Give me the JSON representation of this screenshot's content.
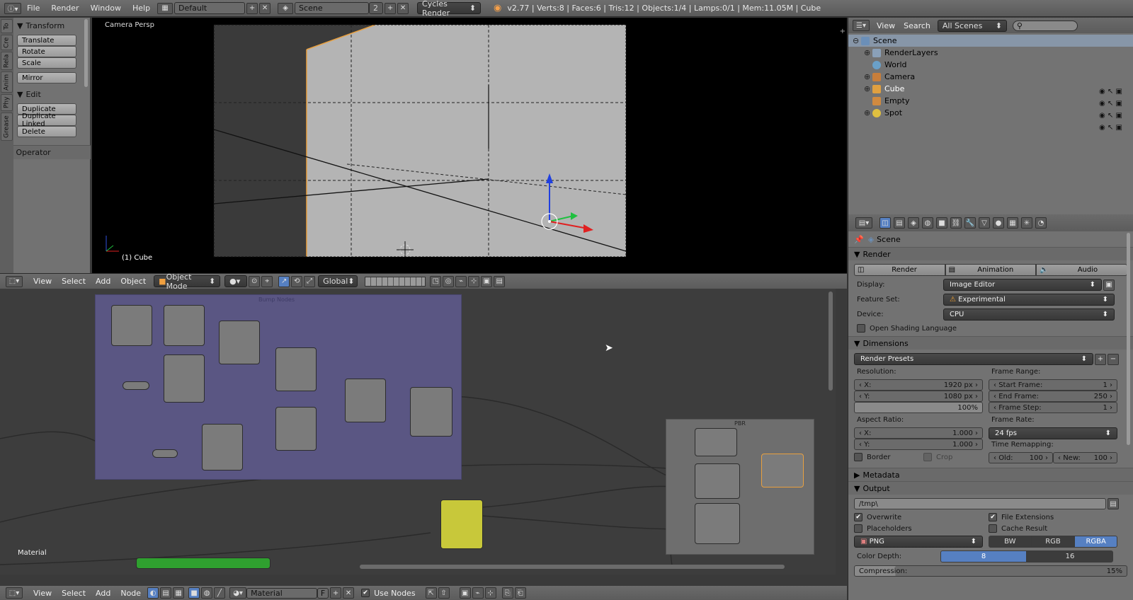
{
  "topbar": {
    "menus": [
      "File",
      "Render",
      "Window",
      "Help"
    ],
    "layout": "Default",
    "scene": "Scene",
    "scene_num": "2",
    "engine": "Cycles Render",
    "stats": "v2.77 | Verts:8 | Faces:6 | Tris:12 | Objects:1/4 | Lamps:0/1 | Mem:11.05M | Cube"
  },
  "toolshelf": {
    "tabs": [
      "To",
      "Cre",
      "Rela",
      "Anim",
      "Phy",
      "Grease"
    ],
    "transform_title": "Transform",
    "transform": [
      "Translate",
      "Rotate",
      "Scale"
    ],
    "mirror": "Mirror",
    "edit_title": "Edit",
    "edit": [
      "Duplicate",
      "Duplicate Linked",
      "Delete"
    ],
    "operator_title": "Operator"
  },
  "viewport": {
    "label": "Camera Persp",
    "object": "(1) Cube"
  },
  "view_header": {
    "menus": [
      "View",
      "Select",
      "Add",
      "Object"
    ],
    "mode": "Object Mode",
    "orientation": "Global"
  },
  "node_editor": {
    "frame_title": "Bump Nodes",
    "pbr_title": "PBR",
    "material_node": "Material",
    "header_menus": [
      "View",
      "Select",
      "Add",
      "Node"
    ],
    "material": "Material",
    "f_label": "F",
    "use_nodes": "Use Nodes"
  },
  "outliner": {
    "menus": [
      "View",
      "Search"
    ],
    "filter": "All Scenes",
    "items": [
      {
        "label": "Scene",
        "color": "#6b8fb8",
        "indent": 0
      },
      {
        "label": "RenderLayers",
        "color": "#8aa0b8",
        "indent": 1
      },
      {
        "label": "World",
        "color": "#6aa0c8",
        "indent": 1
      },
      {
        "label": "Camera",
        "color": "#c87e3b",
        "indent": 1
      },
      {
        "label": "Cube",
        "color": "#e0a040",
        "indent": 1
      },
      {
        "label": "Empty",
        "color": "#d08a40",
        "indent": 1
      },
      {
        "label": "Spot",
        "color": "#e0c040",
        "indent": 1
      }
    ]
  },
  "properties": {
    "context": "Scene",
    "render_title": "Render",
    "render_buttons": [
      "Render",
      "Animation",
      "Audio"
    ],
    "display_label": "Display:",
    "display": "Image Editor",
    "feature_label": "Feature Set:",
    "feature": "Experimental",
    "device_label": "Device:",
    "device": "CPU",
    "osl": "Open Shading Language",
    "dimensions_title": "Dimensions",
    "presets": "Render Presets",
    "resolution_label": "Resolution:",
    "res_x_label": "X:",
    "res_x": "1920 px",
    "res_y_label": "Y:",
    "res_y": "1080 px",
    "res_pct": "100%",
    "frame_range_label": "Frame Range:",
    "start_label": "Start Frame:",
    "start": "1",
    "end_label": "End Frame:",
    "end": "250",
    "step_label": "Frame Step:",
    "step": "1",
    "aspect_label": "Aspect Ratio:",
    "asp_x": "1.000",
    "asp_y": "1.000",
    "frame_rate_label": "Frame Rate:",
    "frame_rate": "24 fps",
    "border": "Border",
    "crop": "Crop",
    "remap_label": "Time Remapping:",
    "old_label": "Old:",
    "old": "100",
    "new_label": "New:",
    "new": "100",
    "metadata_title": "Metadata",
    "output_title": "Output",
    "path": "/tmp\\",
    "overwrite": "Overwrite",
    "file_ext": "File Extensions",
    "placeholders": "Placeholders",
    "cache": "Cache Result",
    "format": "PNG",
    "bw": "BW",
    "rgb": "RGB",
    "rgba": "RGBA",
    "depth_label": "Color Depth:",
    "depth8": "8",
    "depth16": "16",
    "compression_label": "Compression:",
    "compression": "15%"
  }
}
